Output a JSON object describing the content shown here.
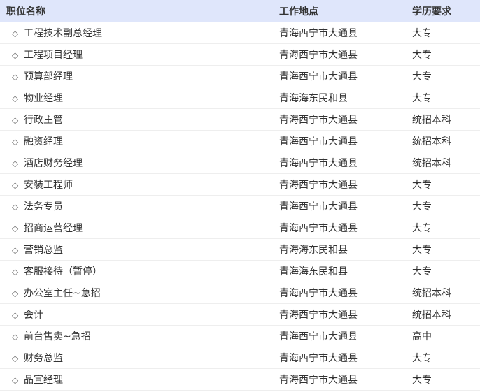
{
  "headers": {
    "title": "职位名称",
    "location": "工作地点",
    "education": "学历要求"
  },
  "bullet": "◇",
  "jobs": [
    {
      "title": "工程技术副总经理",
      "location": "青海西宁市大通县",
      "education": "大专"
    },
    {
      "title": "工程项目经理",
      "location": "青海西宁市大通县",
      "education": "大专"
    },
    {
      "title": "预算部经理",
      "location": "青海西宁市大通县",
      "education": "大专"
    },
    {
      "title": "物业经理",
      "location": "青海海东民和县",
      "education": "大专"
    },
    {
      "title": "行政主管",
      "location": "青海西宁市大通县",
      "education": "统招本科"
    },
    {
      "title": "融资经理",
      "location": "青海西宁市大通县",
      "education": "统招本科"
    },
    {
      "title": "酒店财务经理",
      "location": "青海西宁市大通县",
      "education": "统招本科"
    },
    {
      "title": "安装工程师",
      "location": "青海西宁市大通县",
      "education": "大专"
    },
    {
      "title": "法务专员",
      "location": "青海西宁市大通县",
      "education": "大专"
    },
    {
      "title": "招商运营经理",
      "location": "青海西宁市大通县",
      "education": "大专"
    },
    {
      "title": "营销总监",
      "location": "青海海东民和县",
      "education": "大专"
    },
    {
      "title": "客服接待（暂停）",
      "location": "青海海东民和县",
      "education": "大专"
    },
    {
      "title": "办公室主任~急招",
      "location": "青海西宁市大通县",
      "education": "统招本科"
    },
    {
      "title": "会计",
      "location": "青海西宁市大通县",
      "education": "统招本科"
    },
    {
      "title": "前台售卖~急招",
      "location": "青海西宁市大通县",
      "education": "高中"
    },
    {
      "title": "财务总监",
      "location": "青海西宁市大通县",
      "education": "大专"
    },
    {
      "title": "品宣经理",
      "location": "青海西宁市大通县",
      "education": "大专"
    }
  ]
}
